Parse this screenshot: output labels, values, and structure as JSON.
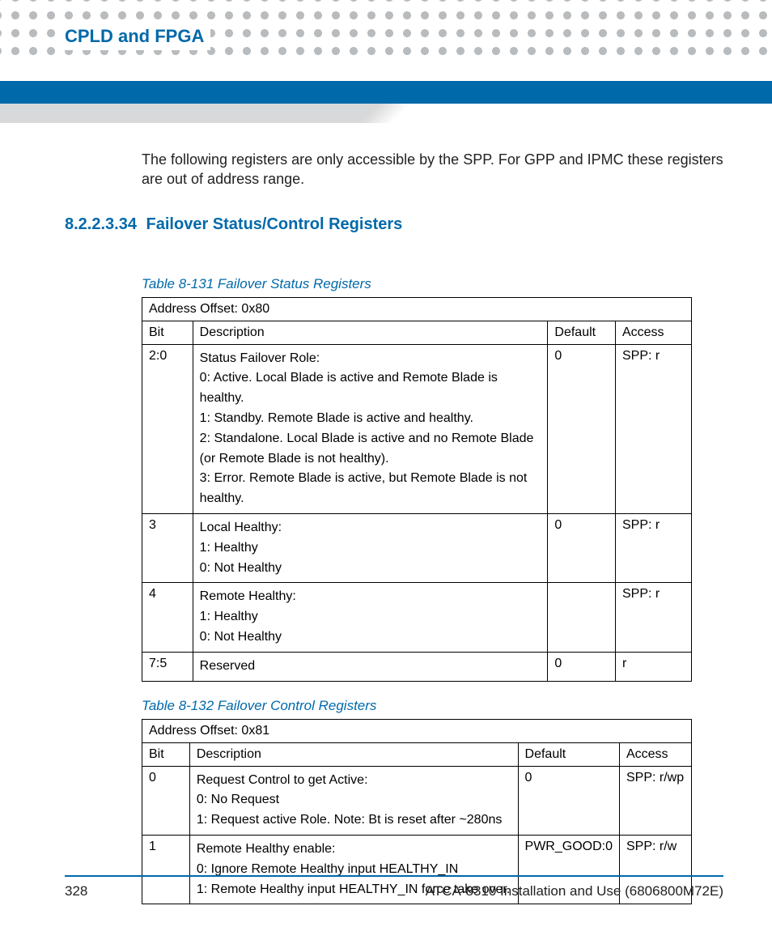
{
  "chapter_title": "CPLD and FPGA",
  "intro_text": "The following registers are only accessible by the SPP. For GPP and IPMC these registers are out of address range.",
  "section": {
    "number": "8.2.2.3.34",
    "title": "Failover Status/Control Registers"
  },
  "tables": [
    {
      "caption": "Table 8-131 Failover Status Registers",
      "address_offset": "Address Offset: 0x80",
      "headers": {
        "bit": "Bit",
        "desc": "Description",
        "def": "Default",
        "acc": "Access"
      },
      "rows": [
        {
          "bit": "2:0",
          "desc": [
            "Status Failover Role:",
            "0: Active. Local Blade is active and Remote Blade is healthy.",
            "1: Standby. Remote Blade is active and healthy.",
            "2: Standalone. Local Blade is active and no Remote Blade (or Remote Blade is not healthy).",
            "3: Error. Remote Blade is active, but Remote Blade is not healthy."
          ],
          "def": "0",
          "acc": "SPP: r"
        },
        {
          "bit": "3",
          "desc": [
            "Local Healthy:",
            "1: Healthy",
            "0: Not Healthy"
          ],
          "def": "0",
          "acc": "SPP: r"
        },
        {
          "bit": "4",
          "desc": [
            "Remote Healthy:",
            "1: Healthy",
            "0: Not Healthy"
          ],
          "def": "",
          "acc": "SPP: r"
        },
        {
          "bit": "7:5",
          "desc": [
            "Reserved"
          ],
          "def": "0",
          "acc": "r"
        }
      ]
    },
    {
      "caption": "Table 8-132 Failover Control Registers",
      "address_offset": "Address Offset: 0x81",
      "headers": {
        "bit": "Bit",
        "desc": "Description",
        "def": "Default",
        "acc": "Access"
      },
      "rows": [
        {
          "bit": "0",
          "desc": [
            "Request Control to get Active:",
            "0: No Request",
            "1: Request active Role. Note: Bt is reset after ~280ns"
          ],
          "def": "0",
          "acc": "SPP: r/wp"
        },
        {
          "bit": "1",
          "desc": [
            "Remote Healthy enable:",
            "0: Ignore Remote Healthy input HEALTHY_IN",
            "1: Remote Healthy input HEALTHY_IN force take over."
          ],
          "def": "PWR_GOOD:0",
          "acc": "SPP: r/w"
        }
      ]
    }
  ],
  "footer": {
    "page": "328",
    "doc": "ATCA-8310 Installation and Use (6806800M72E)"
  }
}
